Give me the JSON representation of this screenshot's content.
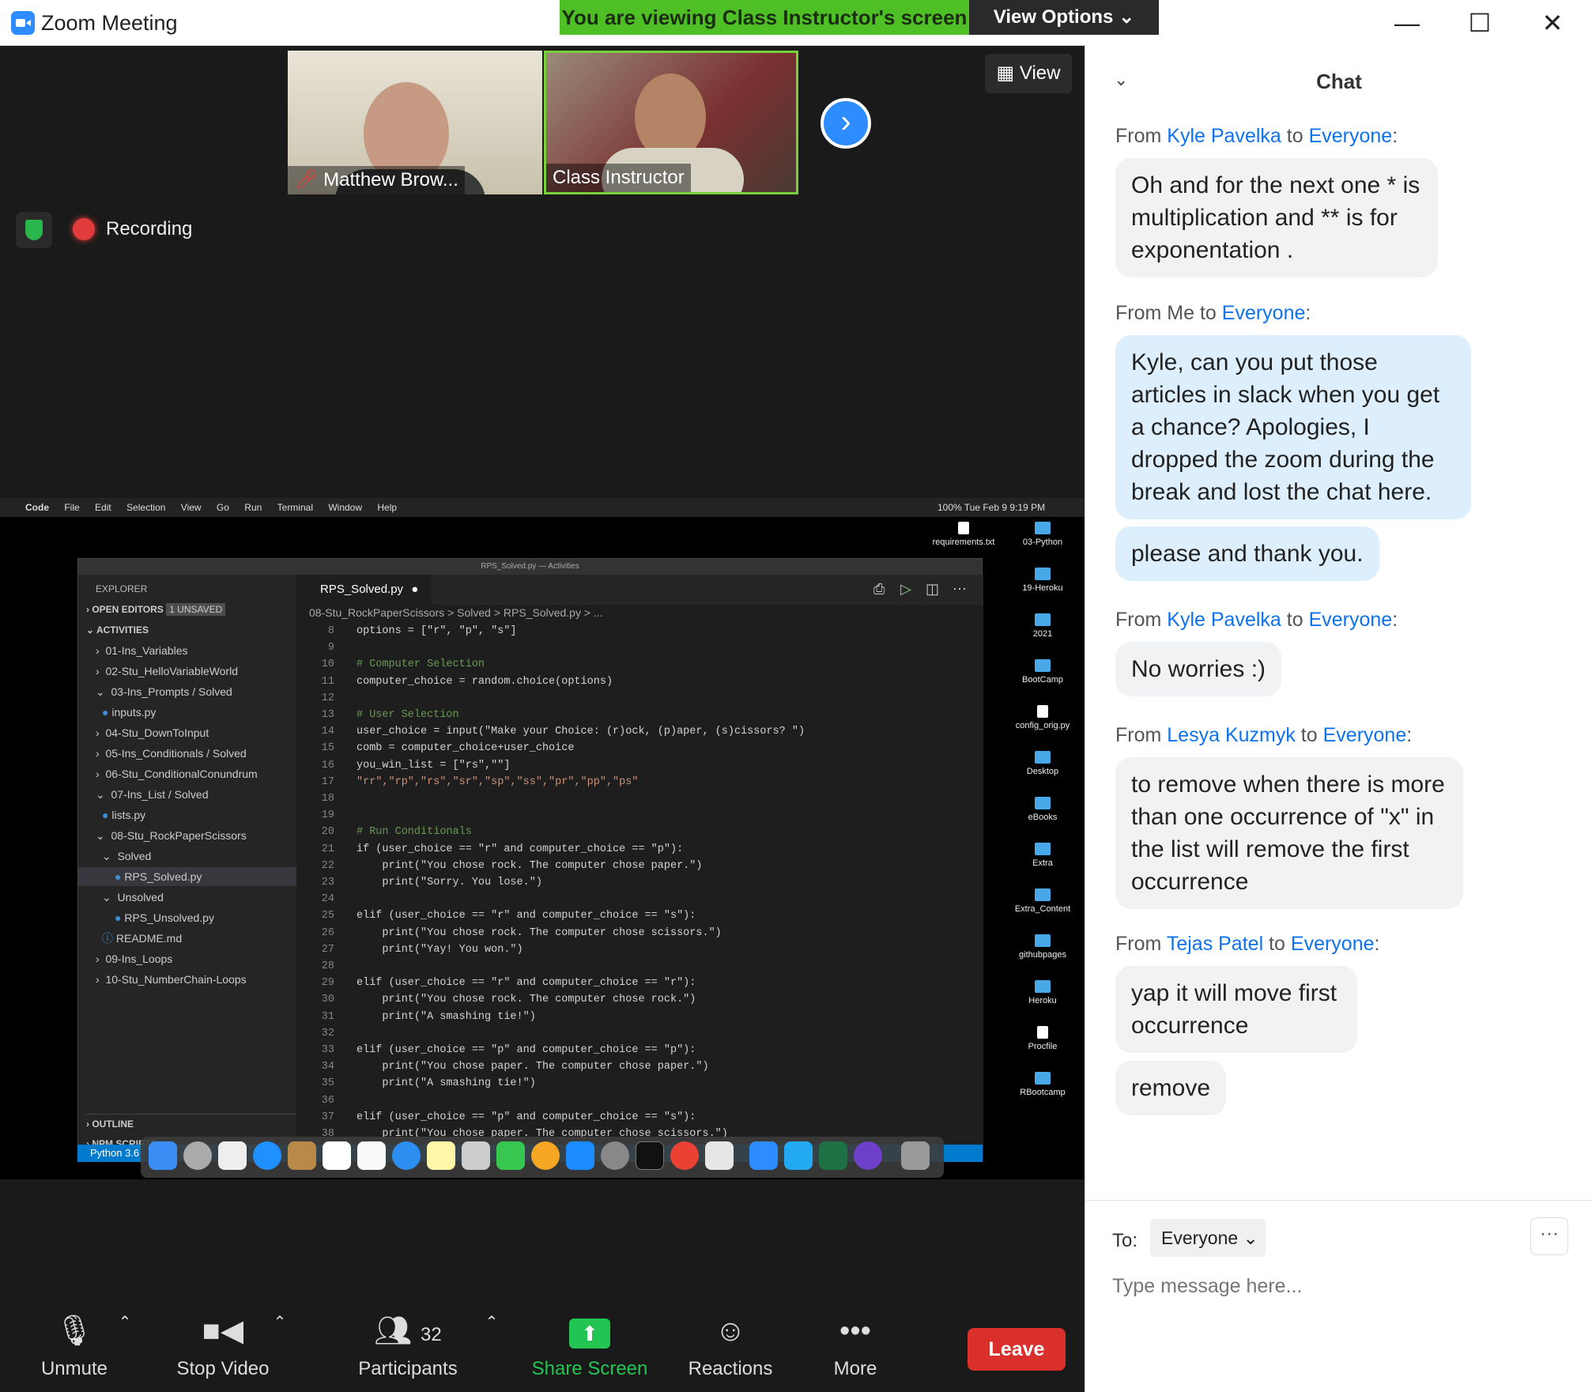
{
  "window": {
    "title": "Zoom Meeting",
    "minimize": "—",
    "maximize": "☐",
    "close": "✕"
  },
  "banner": {
    "text": "You are viewing Class Instructor's screen",
    "view_options": "View Options ⌄"
  },
  "video": {
    "tiles": [
      {
        "name": "Matthew Brow..."
      },
      {
        "name": "Class Instructor"
      }
    ],
    "next": "›",
    "view_button": "View",
    "recording": "Recording"
  },
  "shared_screen": {
    "mac_menu": [
      "Code",
      "File",
      "Edit",
      "Selection",
      "View",
      "Go",
      "Run",
      "Terminal",
      "Window",
      "Help"
    ],
    "mac_status": "100%  Tue Feb 9  9:19 PM",
    "window_title": "RPS_Solved.py — Activities",
    "explorer": {
      "header": "EXPLORER",
      "open_editors": "OPEN EDITORS",
      "unsaved_badge": "1 UNSAVED",
      "activities": "ACTIVITIES",
      "items": [
        "01-Ins_Variables",
        "02-Stu_HelloVariableWorld",
        "03-Ins_Prompts / Solved",
        "inputs.py",
        "04-Stu_DownToInput",
        "05-Ins_Conditionals / Solved",
        "06-Stu_ConditionalConundrum",
        "07-Ins_List / Solved",
        "lists.py",
        "08-Stu_RockPaperScissors",
        "Solved",
        "RPS_Solved.py",
        "Unsolved",
        "RPS_Unsolved.py",
        "README.md",
        "09-Ins_Loops",
        "10-Stu_NumberChain-Loops"
      ],
      "outline": "OUTLINE",
      "npm": "NPM SCRIPTS"
    },
    "tab": "RPS_Solved.py",
    "breadcrumb": "08-Stu_RockPaperScissors  >  Solved  >  RPS_Solved.py  >  ...",
    "code_lines": [
      {
        "n": "8",
        "t": "options = [\"r\", \"p\", \"s\"]"
      },
      {
        "n": "9",
        "t": ""
      },
      {
        "n": "10",
        "t": "# Computer Selection"
      },
      {
        "n": "11",
        "t": "computer_choice = random.choice(options)"
      },
      {
        "n": "12",
        "t": ""
      },
      {
        "n": "13",
        "t": "# User Selection"
      },
      {
        "n": "14",
        "t": "user_choice = input(\"Make your Choice: (r)ock, (p)aper, (s)cissors? \")"
      },
      {
        "n": "15",
        "t": "comb = computer_choice+user_choice"
      },
      {
        "n": "16",
        "t": "you_win_list = [\"rs\",\"\"]"
      },
      {
        "n": "17",
        "t": "\"rr\",\"rp\",\"rs\",\"sr\",\"sp\",\"ss\",\"pr\",\"pp\",\"ps\""
      },
      {
        "n": "18",
        "t": ""
      },
      {
        "n": "19",
        "t": ""
      },
      {
        "n": "20",
        "t": "# Run Conditionals"
      },
      {
        "n": "21",
        "t": "if (user_choice == \"r\" and computer_choice == \"p\"):"
      },
      {
        "n": "22",
        "t": "    print(\"You chose rock. The computer chose paper.\")"
      },
      {
        "n": "23",
        "t": "    print(\"Sorry. You lose.\")"
      },
      {
        "n": "24",
        "t": ""
      },
      {
        "n": "25",
        "t": "elif (user_choice == \"r\" and computer_choice == \"s\"):"
      },
      {
        "n": "26",
        "t": "    print(\"You chose rock. The computer chose scissors.\")"
      },
      {
        "n": "27",
        "t": "    print(\"Yay! You won.\")"
      },
      {
        "n": "28",
        "t": ""
      },
      {
        "n": "29",
        "t": "elif (user_choice == \"r\" and computer_choice == \"r\"):"
      },
      {
        "n": "30",
        "t": "    print(\"You chose rock. The computer chose rock.\")"
      },
      {
        "n": "31",
        "t": "    print(\"A smashing tie!\")"
      },
      {
        "n": "32",
        "t": ""
      },
      {
        "n": "33",
        "t": "elif (user_choice == \"p\" and computer_choice == \"p\"):"
      },
      {
        "n": "34",
        "t": "    print(\"You chose paper. The computer chose paper.\")"
      },
      {
        "n": "35",
        "t": "    print(\"A smashing tie!\")"
      },
      {
        "n": "36",
        "t": ""
      },
      {
        "n": "37",
        "t": "elif (user_choice == \"p\" and computer_choice == \"s\"):"
      },
      {
        "n": "38",
        "t": "    print(\"You chose paper. The computer chose scissors.\")"
      }
    ],
    "status_python": "Python 3.6",
    "desktop_items": [
      "requirements.txt",
      "03-Python",
      "19-Heroku",
      "2021",
      "BootCamp",
      "config_orig.py",
      "Desktop",
      "eBooks",
      "Extra",
      "Extra_Content",
      "githubpages",
      "Heroku",
      "Procfile",
      "RBootcamp"
    ]
  },
  "toolbar": {
    "unmute": "Unmute",
    "stop_video": "Stop Video",
    "participants": "Participants",
    "participants_count": "32",
    "share_screen": "Share Screen",
    "reactions": "Reactions",
    "more": "More",
    "leave": "Leave"
  },
  "chat": {
    "title": "Chat",
    "messages": [
      {
        "from": "Kyle Pavelka",
        "to": "Everyone",
        "text": "Oh and for the next one * is multiplication and ** is for exponentation ."
      },
      {
        "from": "Me",
        "to": "Everyone",
        "text": "Kyle, can you put those articles in slack when you get a chance? Apologies, I dropped the zoom during the break and lost the chat here."
      },
      {
        "text": "please and thank you."
      },
      {
        "from": "Kyle Pavelka",
        "to": "Everyone",
        "text": "No worries :)"
      },
      {
        "from": "Lesya Kuzmyk",
        "to": "Everyone",
        "text": "to remove when there is more than one occurrence of \"x\" in the list will remove the first occurrence"
      },
      {
        "from": "Tejas Patel",
        "to": "Everyone",
        "text": "yap it will move first occurrence"
      },
      {
        "text": "remove"
      }
    ],
    "words": {
      "from": "From",
      "to": "to"
    },
    "to_label": "To:",
    "recipient": "Everyone ⌄",
    "more": "···",
    "placeholder": "Type message here..."
  },
  "colors": {
    "accent": "#2d8cff",
    "banner": "#4fbf26",
    "leave": "#d9302c",
    "share": "#23c552",
    "link": "#0e72ed"
  }
}
